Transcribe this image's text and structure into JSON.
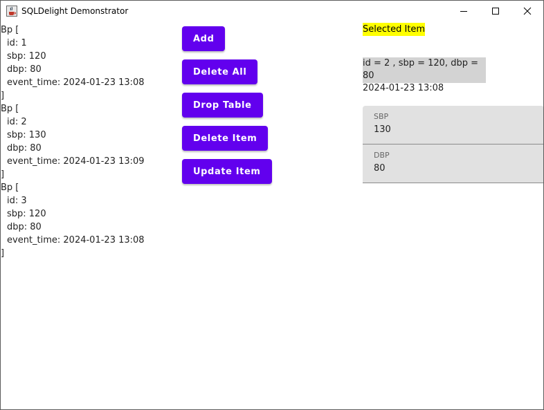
{
  "window": {
    "title": "SQLDelight Demonstrator",
    "icon": "java-cup-icon",
    "controls": [
      "minimize-icon",
      "maximize-icon",
      "close-icon"
    ]
  },
  "records": [
    {
      "open": "Bp [",
      "id": "id: 1",
      "sbp": "sbp: 120",
      "dbp": "dbp: 80",
      "event_time": "event_time: 2024-01-23 13:08",
      "close": "]"
    },
    {
      "open": "Bp [",
      "id": "id: 2",
      "sbp": "sbp: 130",
      "dbp": "dbp: 80",
      "event_time": "event_time: 2024-01-23 13:09",
      "close": "]"
    },
    {
      "open": "Bp [",
      "id": "id: 3",
      "sbp": "sbp: 120",
      "dbp": "dbp: 80",
      "event_time": "event_time: 2024-01-23 13:08",
      "close": "]"
    }
  ],
  "buttons": {
    "add": "Add",
    "delete_all": "Delete All",
    "drop_table": "Drop Table",
    "delete_item": "Delete Item",
    "update_item": "Update Item"
  },
  "selected": {
    "label": "Selected Item",
    "line1": "id = 2 , sbp = 120, dbp = 80",
    "line2": "2024-01-23 13:08"
  },
  "fields": {
    "sbp": {
      "label": "SBP",
      "value": "130"
    },
    "dbp": {
      "label": "DBP",
      "value": "80"
    }
  },
  "colors": {
    "button": "#6200ee",
    "highlight": "#ffff00",
    "selected_bg": "#d3d3d3",
    "field_bg": "#e1e1e1"
  }
}
